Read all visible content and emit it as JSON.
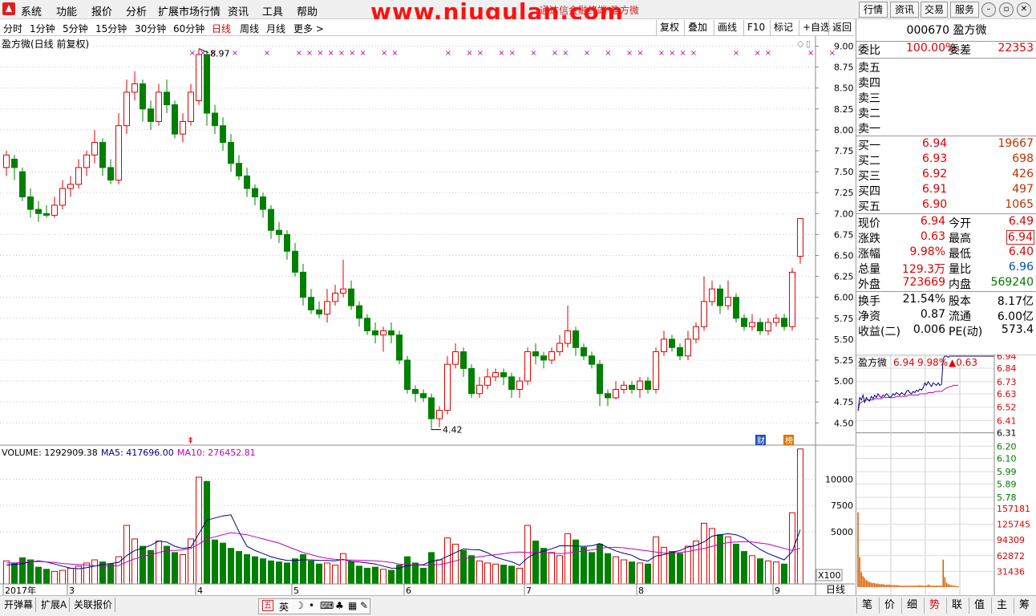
{
  "menu": {
    "items": [
      "系统",
      "功能",
      "报价",
      "分析",
      "扩展市场行情",
      "资讯",
      "工具",
      "帮助"
    ],
    "title": "通达信金融终端    盈方微",
    "watermark": "www.niugulan.com",
    "right_buttons": [
      "行情",
      "资讯",
      "交易",
      "服务"
    ]
  },
  "periods": {
    "items": [
      "分时",
      "1分钟",
      "5分钟",
      "15分钟",
      "30分钟",
      "60分钟",
      "日线",
      "周线",
      "月线",
      "更多 >"
    ],
    "active": "日线",
    "right_buttons": [
      "复权",
      "叠加",
      "画线",
      "F10",
      "标记",
      "+自选",
      "返回"
    ]
  },
  "chart_header": {
    "title": "盈方微(日线 前复权)",
    "high_label": "8.97",
    "low_label": "4.42",
    "volume_label": "VOLUME: 1292909.38",
    "ma5_label": "MA5: 417696.00",
    "ma10_label": "MA10: 276452.81",
    "vol_unit": "X100",
    "tag_cai": "财",
    "tag_bang": "榜",
    "period_tag": "日线"
  },
  "chart_data": {
    "type": "candlestick",
    "y_ticks": [
      "9.00",
      "8.75",
      "8.50",
      "8.25",
      "8.00",
      "7.75",
      "7.50",
      "7.25",
      "7.00",
      "6.75",
      "6.50",
      "6.25",
      "6.00",
      "5.75",
      "5.50",
      "5.25",
      "5.00",
      "4.75",
      "4.50"
    ],
    "ylim": [
      4.33,
      9.12
    ],
    "vol_ticks": [
      "10000",
      "7500",
      "5000"
    ],
    "vol_max": 12500,
    "x_labels": [
      {
        "label": "2017年",
        "index": 0
      },
      {
        "label": "3",
        "index": 8
      },
      {
        "label": "4",
        "index": 24
      },
      {
        "label": "5",
        "index": 36
      },
      {
        "label": "6",
        "index": 50
      },
      {
        "label": "7",
        "index": 65
      },
      {
        "label": "8",
        "index": 79
      },
      {
        "label": "9",
        "index": 96
      }
    ],
    "candles": [
      [
        7.55,
        7.7,
        7.75,
        7.45
      ],
      [
        7.65,
        7.55,
        7.7,
        7.4
      ],
      [
        7.5,
        7.2,
        7.55,
        7.15
      ],
      [
        7.2,
        7.05,
        7.3,
        6.95
      ],
      [
        7.05,
        7.0,
        7.15,
        6.9
      ],
      [
        7.0,
        6.98,
        7.1,
        6.95
      ],
      [
        6.98,
        7.1,
        7.2,
        6.95
      ],
      [
        7.1,
        7.3,
        7.4,
        7.05
      ],
      [
        7.3,
        7.35,
        7.45,
        7.2
      ],
      [
        7.35,
        7.55,
        7.65,
        7.3
      ],
      [
        7.55,
        7.7,
        7.75,
        7.45
      ],
      [
        7.7,
        7.85,
        8.0,
        7.6
      ],
      [
        7.85,
        7.55,
        7.9,
        7.45
      ],
      [
        7.55,
        7.4,
        7.65,
        7.35
      ],
      [
        7.4,
        8.05,
        8.2,
        7.35
      ],
      [
        8.05,
        8.45,
        8.6,
        7.95
      ],
      [
        8.45,
        8.55,
        8.7,
        8.35
      ],
      [
        8.55,
        8.25,
        8.6,
        8.1
      ],
      [
        8.25,
        8.1,
        8.35,
        8.0
      ],
      [
        8.1,
        8.45,
        8.55,
        8.05
      ],
      [
        8.45,
        8.3,
        8.6,
        8.2
      ],
      [
        8.3,
        7.95,
        8.35,
        7.9
      ],
      [
        7.95,
        8.1,
        8.2,
        7.85
      ],
      [
        8.1,
        8.45,
        8.55,
        8.05
      ],
      [
        8.35,
        8.9,
        8.97,
        8.3
      ],
      [
        8.9,
        8.2,
        8.95,
        8.05
      ],
      [
        8.2,
        8.05,
        8.3,
        7.95
      ],
      [
        8.05,
        7.85,
        8.15,
        7.75
      ],
      [
        7.85,
        7.6,
        7.95,
        7.5
      ],
      [
        7.6,
        7.45,
        7.7,
        7.4
      ],
      [
        7.45,
        7.3,
        7.55,
        7.2
      ],
      [
        7.3,
        7.2,
        7.35,
        7.1
      ],
      [
        7.2,
        7.05,
        7.25,
        6.95
      ],
      [
        7.05,
        6.8,
        7.1,
        6.7
      ],
      [
        6.8,
        6.75,
        6.9,
        6.65
      ],
      [
        6.75,
        6.55,
        6.8,
        6.45
      ],
      [
        6.55,
        6.3,
        6.65,
        6.25
      ],
      [
        6.3,
        6.0,
        6.4,
        5.9
      ],
      [
        6.0,
        5.85,
        6.1,
        5.8
      ],
      [
        5.85,
        5.8,
        5.95,
        5.75
      ],
      [
        5.8,
        5.95,
        6.1,
        5.7
      ],
      [
        5.95,
        6.05,
        6.15,
        5.9
      ],
      [
        6.05,
        6.1,
        6.45,
        6.0
      ],
      [
        6.1,
        5.9,
        6.2,
        5.85
      ],
      [
        5.9,
        5.75,
        5.95,
        5.65
      ],
      [
        5.75,
        5.6,
        5.8,
        5.55
      ],
      [
        5.6,
        5.55,
        5.7,
        5.45
      ],
      [
        5.55,
        5.6,
        5.65,
        5.35
      ],
      [
        5.6,
        5.55,
        5.7,
        5.45
      ],
      [
        5.55,
        5.25,
        5.6,
        5.2
      ],
      [
        5.25,
        4.9,
        5.3,
        4.85
      ],
      [
        4.9,
        4.85,
        4.95,
        4.75
      ],
      [
        4.85,
        4.8,
        4.9,
        4.75
      ],
      [
        4.8,
        4.55,
        4.85,
        4.42
      ],
      [
        4.55,
        4.65,
        4.7,
        4.45
      ],
      [
        4.65,
        5.2,
        5.3,
        4.6
      ],
      [
        5.2,
        5.35,
        5.45,
        5.15
      ],
      [
        5.35,
        5.15,
        5.4,
        5.05
      ],
      [
        5.15,
        4.85,
        5.2,
        4.8
      ],
      [
        4.85,
        4.95,
        5.05,
        4.8
      ],
      [
        4.95,
        5.05,
        5.15,
        4.9
      ],
      [
        5.05,
        5.1,
        5.15,
        5.0
      ],
      [
        5.1,
        5.05,
        5.15,
        4.95
      ],
      [
        5.05,
        4.9,
        5.1,
        4.8
      ],
      [
        4.9,
        5.0,
        5.05,
        4.8
      ],
      [
        5.0,
        5.35,
        5.4,
        4.95
      ],
      [
        5.35,
        5.3,
        5.45,
        5.2
      ],
      [
        5.3,
        5.25,
        5.35,
        5.15
      ],
      [
        5.25,
        5.35,
        5.4,
        5.2
      ],
      [
        5.35,
        5.45,
        5.55,
        5.3
      ],
      [
        5.45,
        5.6,
        5.9,
        5.4
      ],
      [
        5.6,
        5.4,
        5.65,
        5.3
      ],
      [
        5.4,
        5.3,
        5.45,
        5.25
      ],
      [
        5.3,
        5.2,
        5.35,
        5.15
      ],
      [
        5.2,
        4.85,
        5.25,
        4.7
      ],
      [
        4.85,
        4.8,
        4.9,
        4.7
      ],
      [
        4.8,
        4.9,
        5.0,
        4.78
      ],
      [
        4.9,
        4.95,
        5.0,
        4.85
      ],
      [
        4.95,
        4.9,
        5.0,
        4.85
      ],
      [
        4.9,
        5.0,
        5.05,
        4.8
      ],
      [
        5.0,
        4.9,
        5.05,
        4.85
      ],
      [
        4.9,
        5.35,
        5.4,
        4.85
      ],
      [
        5.35,
        5.5,
        5.6,
        5.3
      ],
      [
        5.5,
        5.4,
        5.55,
        5.35
      ],
      [
        5.4,
        5.3,
        5.45,
        5.25
      ],
      [
        5.3,
        5.5,
        5.6,
        5.25
      ],
      [
        5.5,
        5.65,
        5.7,
        5.45
      ],
      [
        5.65,
        5.95,
        6.25,
        5.6
      ],
      [
        5.95,
        6.1,
        6.2,
        5.9
      ],
      [
        6.1,
        5.9,
        6.15,
        5.8
      ],
      [
        5.9,
        6.0,
        6.2,
        5.85
      ],
      [
        6.0,
        5.75,
        6.05,
        5.7
      ],
      [
        5.75,
        5.65,
        5.8,
        5.6
      ],
      [
        5.65,
        5.7,
        5.8,
        5.6
      ],
      [
        5.7,
        5.6,
        5.75,
        5.55
      ],
      [
        5.6,
        5.7,
        5.75,
        5.55
      ],
      [
        5.7,
        5.75,
        5.8,
        5.65
      ],
      [
        5.75,
        5.65,
        5.8,
        5.6
      ],
      [
        5.65,
        6.3,
        6.35,
        5.6
      ],
      [
        6.49,
        6.94,
        6.94,
        6.4
      ]
    ],
    "volumes": [
      2200,
      2000,
      2500,
      2300,
      1600,
      1400,
      1200,
      1300,
      1500,
      1700,
      2000,
      2300,
      2100,
      1900,
      2600,
      5600,
      4300,
      3600,
      3200,
      4100,
      3600,
      3000,
      2800,
      4300,
      10200,
      9800,
      4200,
      3900,
      3400,
      3100,
      2800,
      2600,
      2400,
      2200,
      2100,
      2000,
      2400,
      2800,
      2200,
      1900,
      2000,
      1800,
      2900,
      2100,
      1700,
      1500,
      1600,
      1400,
      1300,
      1800,
      2600,
      2000,
      1500,
      3000,
      2300,
      4400,
      3800,
      3200,
      2700,
      2200,
      2000,
      1900,
      1800,
      1700,
      1500,
      5600,
      4100,
      3400,
      3000,
      2700,
      4800,
      4200,
      3500,
      3000,
      3800,
      2900,
      2600,
      2300,
      2100,
      2000,
      1900,
      4500,
      3500,
      3100,
      2900,
      3600,
      4100,
      5800,
      5300,
      4700,
      4500,
      3800,
      3100,
      2700,
      2400,
      2200,
      2100,
      1900,
      6800,
      12900
    ],
    "markers_x": [
      6,
      7,
      8,
      10,
      13,
      16,
      17,
      18,
      19,
      20,
      21,
      22,
      24,
      25,
      30,
      32,
      33,
      35,
      36,
      38,
      40,
      41,
      43,
      45,
      47,
      48,
      50,
      51,
      52,
      53,
      57,
      59,
      60,
      64,
      66,
      69,
      70,
      71,
      72,
      73,
      74
    ],
    "ma5_line": [
      1800,
      1850,
      1950,
      2100,
      2200,
      2100,
      1900,
      1700,
      1500,
      1450,
      1550,
      1700,
      1850,
      1950,
      2050,
      2700,
      3200,
      3400,
      3700,
      4100,
      4000,
      3600,
      3400,
      3500,
      4800,
      6100,
      6300,
      6500,
      6600,
      5000,
      3600,
      3200,
      2900,
      2600,
      2400,
      2250,
      2250,
      2300,
      2300,
      2250,
      2250,
      2200,
      2350,
      2150,
      2100,
      2000,
      1900,
      1700,
      1500,
      1520,
      1740,
      1820,
      1840,
      2180,
      2280,
      2640,
      3000,
      3340,
      3280,
      3260,
      2980,
      2560,
      2320,
      2120,
      1780,
      2500,
      2940,
      3140,
      3360,
      3640,
      3640,
      3620,
      3600,
      3640,
      3860,
      3480,
      3160,
      2920,
      2740,
      2340,
      2180,
      2680,
      2800,
      3020,
      3200,
      3520,
      3680,
      4020,
      4560,
      4700,
      4800,
      4700,
      4400,
      3800,
      3300,
      2900,
      2600,
      2300,
      3100,
      5180
    ],
    "ma10_line": [
      2000,
      2000,
      2050,
      2100,
      2150,
      2100,
      2050,
      1950,
      1900,
      1850,
      1800,
      1750,
      1700,
      1700,
      1750,
      2100,
      2400,
      2600,
      2800,
      3000,
      3200,
      3200,
      3250,
      3400,
      3800,
      4300,
      4500,
      4700,
      4900,
      4800,
      4700,
      4500,
      4300,
      4100,
      3900,
      3600,
      3300,
      3000,
      2800,
      2600,
      2450,
      2350,
      2300,
      2280,
      2260,
      2250,
      2200,
      2150,
      2050,
      1900,
      1850,
      1800,
      1780,
      1800,
      1850,
      2000,
      2200,
      2400,
      2500,
      2600,
      2700,
      2800,
      2900,
      3000,
      3050,
      3000,
      3000,
      3000,
      2950,
      2900,
      2950,
      3050,
      3150,
      3250,
      3400,
      3500,
      3500,
      3450,
      3350,
      3250,
      3150,
      3050,
      2950,
      2950,
      3000,
      3100,
      3250,
      3400,
      3600,
      3800,
      3950,
      4000,
      4050,
      4000,
      3900,
      3800,
      3600,
      3400,
      3200,
      3400
    ],
    "mini_y_ticks_up": [
      "6.94",
      "6.84",
      "6.73",
      "6.63",
      "6.52",
      "6.41",
      "6.31"
    ],
    "mini_y_ticks_down": [
      "6.20",
      "6.10",
      "5.99",
      "5.89",
      "5.78"
    ],
    "mini_vol_ticks": [
      "157181",
      "125745",
      "94309",
      "62872",
      "31436"
    ],
    "mini_price": [
      6.49,
      6.6,
      6.58,
      6.62,
      6.56,
      6.6,
      6.58,
      6.57,
      6.61,
      6.59,
      6.62,
      6.6,
      6.63,
      6.61,
      6.6,
      6.62,
      6.61,
      6.63,
      6.62,
      6.6,
      6.61,
      6.63,
      6.62,
      6.64,
      6.63,
      6.62,
      6.64,
      6.63,
      6.62,
      6.65,
      6.66,
      6.64,
      6.63,
      6.65,
      6.64,
      6.66,
      6.65,
      6.67,
      6.66,
      6.68,
      6.72,
      6.7,
      6.73,
      6.71,
      6.69,
      6.72,
      6.71,
      6.7,
      6.72,
      6.7,
      6.71,
      6.92,
      6.94,
      6.94,
      6.93,
      6.94,
      6.94,
      6.94,
      6.94,
      6.94,
      6.94
    ],
    "mini_avg": [
      6.49,
      6.55,
      6.56,
      6.57,
      6.57,
      6.58,
      6.58,
      6.58,
      6.58,
      6.58,
      6.59,
      6.59,
      6.59,
      6.59,
      6.59,
      6.6,
      6.6,
      6.6,
      6.6,
      6.6,
      6.6,
      6.6,
      6.6,
      6.61,
      6.61,
      6.61,
      6.61,
      6.61,
      6.61,
      6.61,
      6.62,
      6.62,
      6.62,
      6.62,
      6.62,
      6.62,
      6.62,
      6.63,
      6.63,
      6.63,
      6.63,
      6.63,
      6.64,
      6.64,
      6.64,
      6.64,
      6.65,
      6.65,
      6.65,
      6.65,
      6.65,
      6.66,
      6.67,
      6.68,
      6.68,
      6.69,
      6.69,
      6.7,
      6.7,
      6.7,
      6.7
    ],
    "mini_vol": [
      150000,
      60000,
      30000,
      22000,
      18000,
      14000,
      12000,
      10000,
      9000,
      8000,
      8000,
      7000,
      7000,
      6000,
      6000,
      6000,
      5000,
      5000,
      5000,
      5000,
      4000,
      4000,
      4000,
      4000,
      4000,
      3000,
      3000,
      3000,
      3000,
      3000,
      3000,
      3000,
      3000,
      3000,
      3000,
      3000,
      3000,
      4000,
      3000,
      3000,
      3000,
      3000,
      5000,
      4000,
      3000,
      3000,
      3000,
      3000,
      3000,
      3000,
      3000,
      55000,
      20000,
      9000,
      6000,
      5000,
      4000,
      3000,
      3000,
      2000,
      2000
    ]
  },
  "quote": {
    "code_title": "000670 盈方微",
    "weibi_label": "委比",
    "weibi_value": "100.00%",
    "weicha_label": "委差",
    "weicha_value": "22353",
    "sell": [
      "卖五",
      "卖四",
      "卖三",
      "卖二",
      "卖一"
    ],
    "buy": [
      {
        "label": "买一",
        "price": "6.94",
        "vol": "19667"
      },
      {
        "label": "买二",
        "price": "6.93",
        "vol": "698"
      },
      {
        "label": "买三",
        "price": "6.92",
        "vol": "426"
      },
      {
        "label": "买四",
        "price": "6.91",
        "vol": "497"
      },
      {
        "label": "买五",
        "price": "6.90",
        "vol": "1065"
      }
    ],
    "stats": [
      {
        "l1": "现价",
        "v1": "6.94",
        "c1": "red",
        "l2": "今开",
        "v2": "6.49",
        "c2": "red"
      },
      {
        "l1": "涨跌",
        "v1": "0.63",
        "c1": "red",
        "l2": "最高",
        "v2": "6.94",
        "c2": "red-boxed"
      },
      {
        "l1": "涨幅",
        "v1": "9.98%",
        "c1": "red",
        "l2": "最低",
        "v2": "6.40",
        "c2": "red"
      },
      {
        "l1": "总量",
        "v1": "129.3万",
        "c1": "red",
        "l2": "量比",
        "v2": "6.96",
        "c2": "blue"
      },
      {
        "l1": "外盘",
        "v1": "723669",
        "c1": "red",
        "l2": "内盘",
        "v2": "569240",
        "c2": "green"
      }
    ],
    "fund": [
      {
        "l1": "换手",
        "v1": "21.54%",
        "l2": "股本",
        "v2": "8.17亿"
      },
      {
        "l1": "净资",
        "v1": "0.87",
        "l2": "流通",
        "v2": "6.00亿"
      },
      {
        "l1": "收益(二)",
        "v1": "0.006",
        "l2": "PE(动)",
        "v2": "573.4"
      }
    ]
  },
  "mini_header": {
    "name": "盈方微",
    "price": "6.94",
    "pct": "9.98%",
    "chg": "▲0.63"
  },
  "bottom": {
    "tabs": [
      "开弹幕",
      "扩展A",
      "关联报价"
    ],
    "ime_label": "英",
    "right_tabs": [
      "笔",
      "价",
      "细",
      "势",
      "联",
      "值",
      "主",
      "筹"
    ],
    "right_active": "势"
  },
  "colors": {
    "up": "#e00000",
    "down": "#008000",
    "ma5": "#000080",
    "ma10": "#c000c0",
    "grid": "#c8c8c8"
  }
}
